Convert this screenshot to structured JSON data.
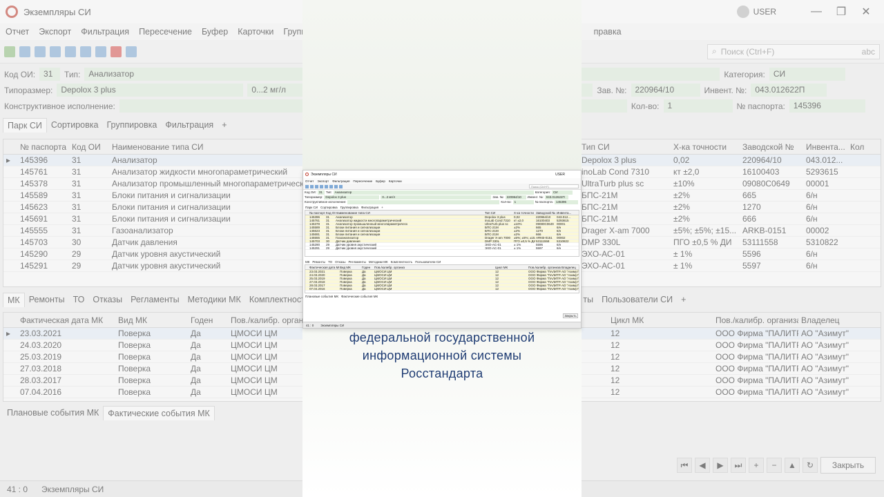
{
  "window": {
    "title": "Экземпляры СИ",
    "user": "USER"
  },
  "menu": [
    "Отчет",
    "Экспорт",
    "Фильтрация",
    "Пересечение",
    "Буфер",
    "Карточки",
    "Групповы",
    "правка"
  ],
  "search": {
    "placeholder": "Поиск (Ctrl+F)",
    "suffix": "abc"
  },
  "card": {
    "kod_oi_label": "Код ОИ:",
    "kod_oi_value": "31",
    "tip_label": "Тип:",
    "tip_value": "Анализатор",
    "kategoriya_label": "Категория:",
    "kategoriya_value": "СИ",
    "tiporazmer_label": "Типоразмер:",
    "tiporazmer_value": "Depolox 3 plus",
    "range_value": "0...2 мг/л",
    "zav_label": "Зав. №:",
    "zav_value": "220964/10",
    "invent_label": "Инвент. №:",
    "invent_value": "043.012622П",
    "konstr_label": "Конструктивное исполнение:",
    "kolvo_label": "Кол-во:",
    "kolvo_value": "1",
    "pasport_label": "№ паспорта:",
    "pasport_value": "145396"
  },
  "top_tabs": [
    "Парк СИ",
    "Сортировка",
    "Группировка",
    "Фильтрация",
    "+"
  ],
  "main_grid": {
    "left_headers": [
      "№ паспорта",
      "Код ОИ",
      "Наименование типа СИ"
    ],
    "right_headers": [
      "Тип СИ",
      "Х-ка точности",
      "Заводской №",
      "Инвента...",
      "Кол"
    ],
    "rows": [
      {
        "pasport": "145396",
        "kod": "31",
        "name": "Анализатор",
        "tip": "Depolox 3 plus",
        "tochn": "0,02",
        "zav": "220964/10",
        "inv": "043.012..."
      },
      {
        "pasport": "145761",
        "kod": "31",
        "name": "Анализатор жидкости многопараметрический",
        "tip": "inoLab Cond 7310",
        "tochn": "кт ±2,0",
        "zav": "16100403",
        "inv": "5293615"
      },
      {
        "pasport": "145378",
        "kod": "31",
        "name": "Анализатор промышленный многопараметрическ",
        "tip": "UltraTurb plus sc",
        "tochn": "±10%",
        "zav": "09080C0649",
        "inv": "00001"
      },
      {
        "pasport": "145589",
        "kod": "31",
        "name": "Блоки питания и сигнализации",
        "tip": "БПС-21М",
        "tochn": "±2%",
        "zav": "665",
        "inv": "6/н"
      },
      {
        "pasport": "145623",
        "kod": "31",
        "name": "Блоки питания и сигнализации",
        "tip": "БПС-21М",
        "tochn": "±2%",
        "zav": "1270",
        "inv": "6/н"
      },
      {
        "pasport": "145691",
        "kod": "31",
        "name": "Блоки питания и сигнализации",
        "tip": "БПС-21М",
        "tochn": "±2%",
        "zav": "666",
        "inv": "6/н"
      },
      {
        "pasport": "145555",
        "kod": "31",
        "name": "Газоанализатор",
        "tip": "Drager X-am 7000",
        "tochn": "±5%; ±5%; ±15...",
        "zav": "ARKB-0151",
        "inv": "00002"
      },
      {
        "pasport": "145703",
        "kod": "30",
        "name": "Датчик давления",
        "tip": "DMP 330L",
        "tochn": "ПГО ±0,5 % ДИ",
        "zav": "53111558",
        "inv": "5310822"
      },
      {
        "pasport": "145290",
        "kod": "29",
        "name": "Датчик уровня акустический",
        "tip": "ЭХО-АС-01",
        "tochn": "± 1%",
        "zav": "5596",
        "inv": "6/н"
      },
      {
        "pasport": "145291",
        "kod": "29",
        "name": "Датчик уровня акустический",
        "tip": "ЭХО-АС-01",
        "tochn": "± 1%",
        "zav": "5597",
        "inv": "6/н"
      }
    ]
  },
  "bottom_tabs_left": [
    "МК",
    "Ремонты",
    "ТО",
    "Отказы",
    "Регламенты",
    "Методики МК",
    "Комплектность"
  ],
  "bottom_tabs_right": [
    "ты",
    "Пользователи СИ",
    "+"
  ],
  "mk_grid": {
    "left_headers": [
      "Фактическая дата МК",
      "Вид МК",
      "Годен",
      "Пов./калибр. организ"
    ],
    "right_headers": [
      "Цикл МК",
      "Пов./калибр. организац...",
      "Владелец"
    ],
    "rows": [
      {
        "date": "23.03.2021",
        "vid": "Поверка",
        "goden": "Да",
        "org": "ЦМОСИ ЦМ",
        "cikl": "12",
        "org2": "ООО Фирма \"ПАЛИТРА...",
        "vlad": "АО \"Азимут\""
      },
      {
        "date": "24.03.2020",
        "vid": "Поверка",
        "goden": "Да",
        "org": "ЦМОСИ ЦМ",
        "cikl": "12",
        "org2": "ООО Фирма \"ПАЛИТРА...",
        "vlad": "АО \"Азимут\""
      },
      {
        "date": "25.03.2019",
        "vid": "Поверка",
        "goden": "Да",
        "org": "ЦМОСИ ЦМ",
        "cikl": "12",
        "org2": "ООО Фирма \"ПАЛИТРА...",
        "vlad": "АО \"Азимут\""
      },
      {
        "date": "27.03.2018",
        "vid": "Поверка",
        "goden": "Да",
        "org": "ЦМОСИ ЦМ",
        "cikl": "12",
        "org2": "ООО Фирма \"ПАЛИТРА...",
        "vlad": "АО \"Азимут\""
      },
      {
        "date": "28.03.2017",
        "vid": "Поверка",
        "goden": "Да",
        "org": "ЦМОСИ ЦМ",
        "cikl": "12",
        "org2": "ООО Фирма \"ПАЛИТРА...",
        "vlad": "АО \"Азимут\""
      },
      {
        "date": "07.04.2016",
        "vid": "Поверка",
        "goden": "Да",
        "org": "ЦМОСИ ЦМ",
        "cikl": "12",
        "org2": "ООО Фирма \"ПАЛИТРА...",
        "vlad": "АО \"Азимут\""
      }
    ]
  },
  "event_tabs": [
    "Плановые события МК",
    "Фактические события МК"
  ],
  "nav": {
    "close_label": "Закрыть"
  },
  "status": {
    "position": "41 : 0",
    "label": "Экземпляры СИ"
  },
  "caption": {
    "line1": "федеральной государственной",
    "line2": "информационной системы",
    "line3": "Росстандарта"
  }
}
